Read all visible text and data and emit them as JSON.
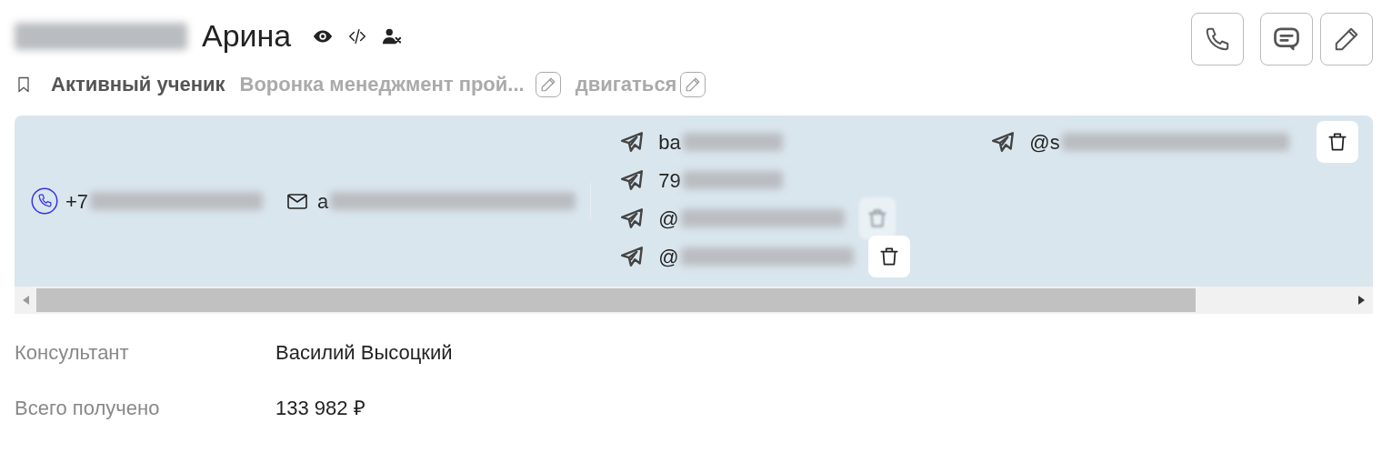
{
  "header": {
    "name_visible": "Арина",
    "name_redacted": true
  },
  "actions": [
    {
      "kind": "phone"
    },
    {
      "kind": "chat"
    },
    {
      "kind": "edit"
    }
  ],
  "tags": [
    {
      "kind": "status",
      "text": "Активный ученик"
    },
    {
      "kind": "funnel",
      "text": "Воронка менеджмент прой...",
      "editable": true
    },
    {
      "kind": "stage",
      "text": "двигаться",
      "editable": true
    }
  ],
  "contacts": {
    "phone": {
      "text": "+7",
      "redacted": true
    },
    "email": {
      "text": "a",
      "redacted": true
    },
    "telegram_columns": [
      [
        {
          "text": "ba",
          "redacted": true,
          "deletable": false
        },
        {
          "text": "79",
          "redacted": true,
          "deletable": false
        },
        {
          "text": "@",
          "redacted": true,
          "deletable": true,
          "delete_faded": true
        },
        {
          "text": "@",
          "redacted": true,
          "deletable": true,
          "delete_faded": false
        }
      ],
      [
        {
          "text": "@s",
          "redacted": true,
          "deletable": true,
          "delete_faded": false
        }
      ]
    ]
  },
  "fields": [
    {
      "label": "Консультант",
      "value": "Василий Высоцкий"
    },
    {
      "label": "Всего получено",
      "value": "133 982 ₽"
    }
  ]
}
